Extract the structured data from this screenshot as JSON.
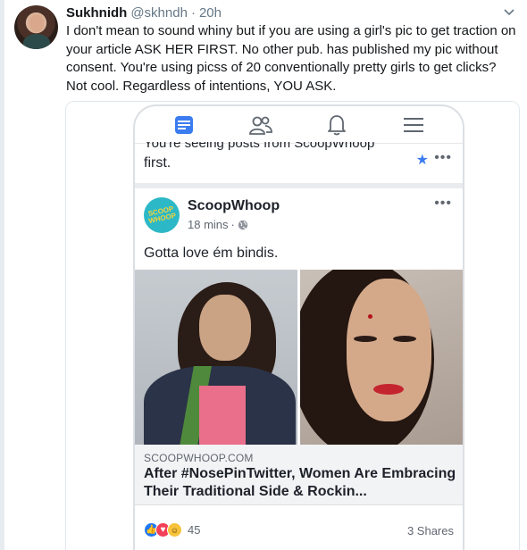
{
  "tweet": {
    "display_name": "Sukhnidh",
    "handle": "@skhndh",
    "separator": "·",
    "time": "20h",
    "text": "I don't mean to sound whiny but if you are using a girl's pic to get traction on your article ASK HER FIRST. No other pub. has published my pic without consent. You're using picss of 20  conventionally pretty girls to get clicks? Not cool. Regardless of intentions, YOU ASK."
  },
  "screenshot": {
    "notice_partial": "You're seeing posts from ScoopWhoop",
    "notice_line": "first.",
    "notice_more": "•••",
    "post": {
      "page_name": "ScoopWhoop",
      "logo_text": "SCOOP WHOOP",
      "time": "18 mins",
      "meta_dot": "·",
      "more": "•••",
      "caption": "Gotta love ém bindis.",
      "link_domain": "SCOOPWHOOP.COM",
      "link_title": "After #NosePinTwitter, Women Are Embracing Their Traditional Side & Rockin...",
      "reaction_count": "45",
      "shares": "3 Shares"
    }
  },
  "icons": [
    "chevron-down-icon",
    "news-feed-icon",
    "friends-icon",
    "notifications-icon",
    "menu-icon",
    "star-icon",
    "globe-icon",
    "like-reaction-icon",
    "love-reaction-icon",
    "haha-reaction-icon"
  ],
  "colors": {
    "facebook_blue": "#3b7cf0",
    "tweet_secondary": "#657786",
    "scoopwhoop_teal": "#2cb8c7"
  }
}
